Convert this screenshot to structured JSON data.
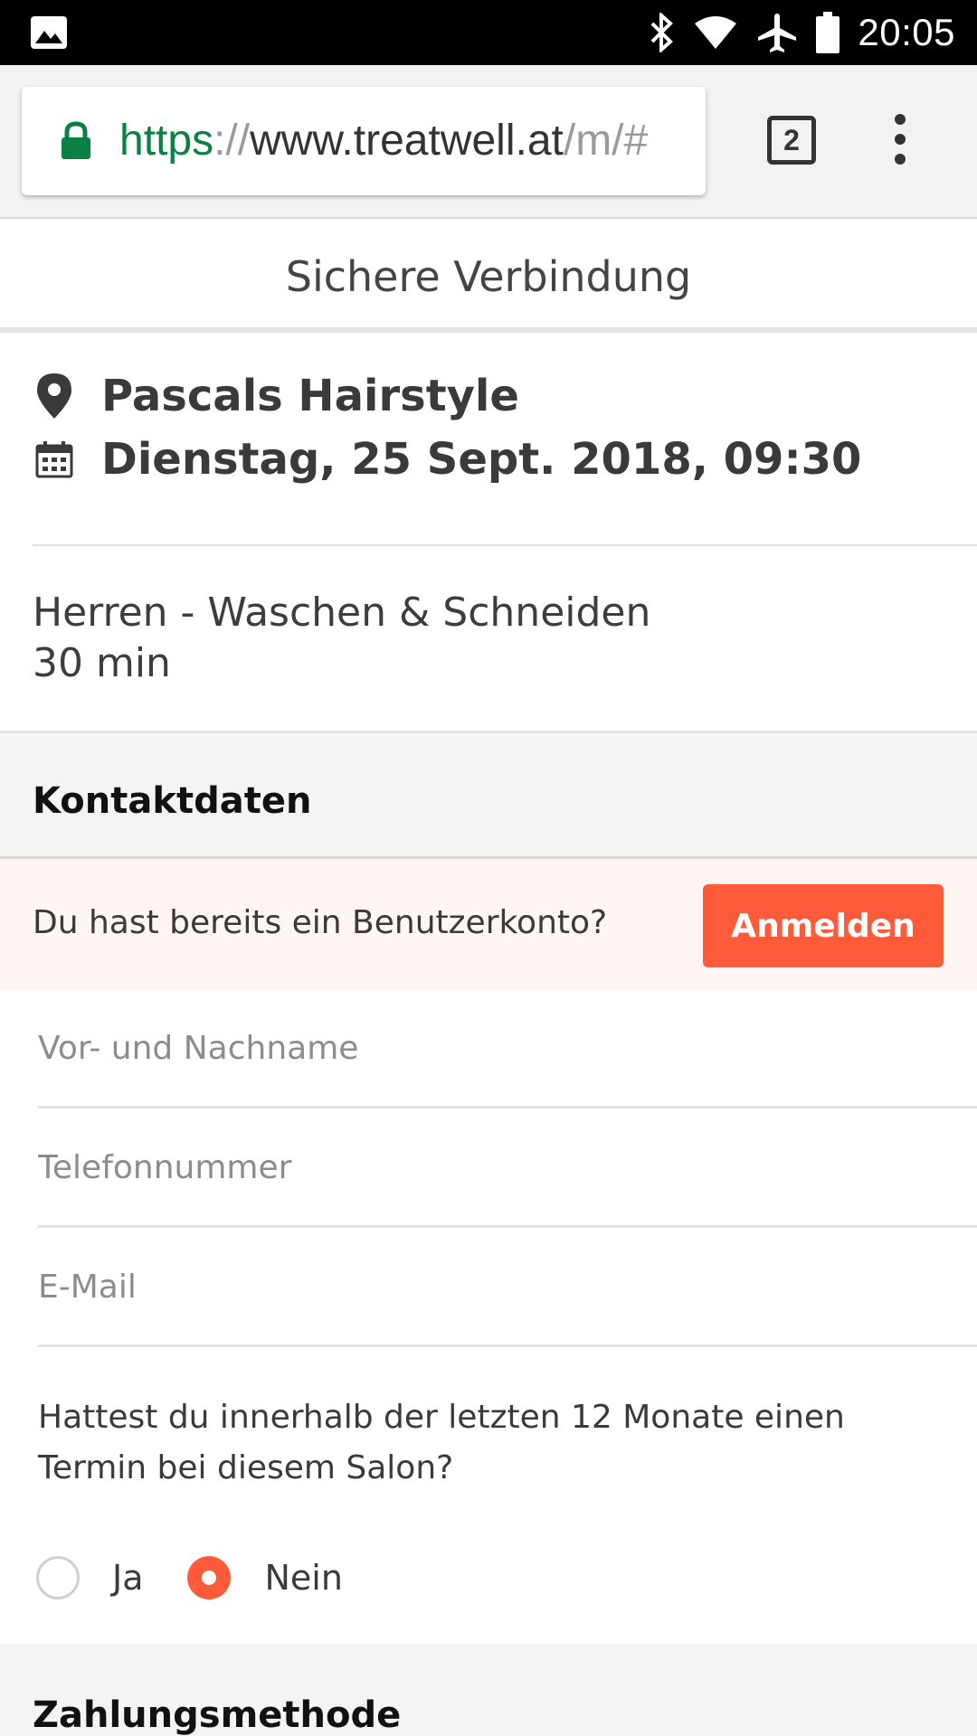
{
  "status_bar": {
    "time": "20:05",
    "icons": [
      "image-icon",
      "bluetooth-icon",
      "wifi-icon",
      "airplane-icon",
      "battery-icon"
    ]
  },
  "browser": {
    "url_scheme": "https",
    "url_separator": "://",
    "url_host": "www.treatwell.at",
    "url_path": "/m/#",
    "tab_count": "2",
    "lock_color": "#0b8043"
  },
  "secure_banner": "Sichere Verbindung",
  "salon": {
    "name": "Pascals Hairstyle",
    "datetime": "Dienstag, 25 Sept. 2018, 09:30"
  },
  "service": {
    "name": "Herren - Waschen & Schneiden",
    "duration": "30 min"
  },
  "contact": {
    "section_title": "Kontaktdaten",
    "login_question": "Du hast bereits ein Benutzerkonto?",
    "login_button": "Anmelden",
    "name_placeholder": "Vor- und Nachname",
    "phone_placeholder": "Telefonnummer",
    "email_placeholder": "E-Mail",
    "question": "Hattest du innerhalb der letzten 12 Monate einen Termin bei diesem Salon?",
    "options": [
      {
        "label": "Ja",
        "checked": false
      },
      {
        "label": "Nein",
        "checked": true
      }
    ]
  },
  "payment": {
    "section_title": "Zahlungsmethode"
  },
  "colors": {
    "accent": "#ff5a3a",
    "login_bg": "#fdf6f3"
  }
}
